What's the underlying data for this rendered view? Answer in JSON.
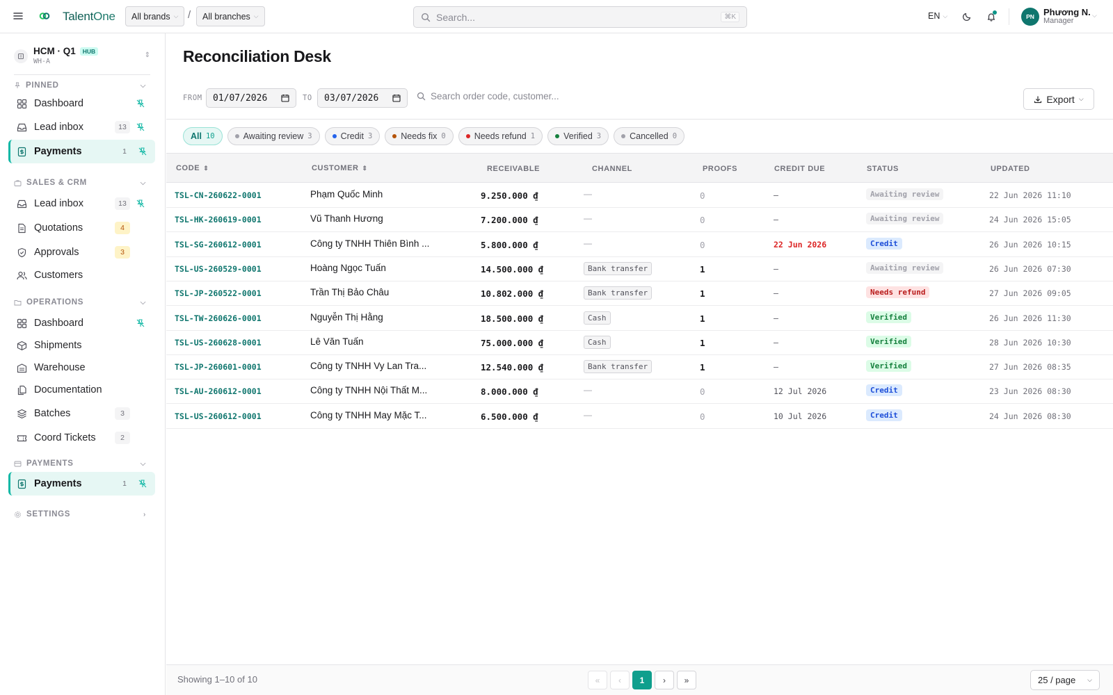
{
  "topbar": {
    "app_name_a": "Talent",
    "app_name_b": "One",
    "brand_select": "All brands",
    "separator": "/",
    "branch_select": "All branches",
    "search_placeholder": "Search...",
    "search_shortcut": "⌘K",
    "language": "EN",
    "user_initials": "PN",
    "user_name": "Phương N.",
    "user_role": "Manager",
    "icons": [
      "menu-icon",
      "logo-icon",
      "search-icon",
      "moon-icon",
      "bell-icon"
    ]
  },
  "sidebar": {
    "workspace": {
      "name": "HCM · Q1",
      "badge": "HUB",
      "code": "WH-A"
    },
    "sections": [
      {
        "label": "PINNED",
        "items": [
          {
            "label": "Dashboard",
            "icon": "grid-icon"
          },
          {
            "label": "Lead inbox",
            "count": "13",
            "icon": "inbox-icon"
          },
          {
            "label": "Payments",
            "count": "1",
            "icon": "receipt-icon",
            "active": true
          }
        ]
      },
      {
        "label": "SALES & CRM",
        "items": [
          {
            "label": "Lead inbox",
            "count": "13",
            "icon": "inbox-icon"
          },
          {
            "label": "Quotations",
            "count": "4",
            "icon": "document-icon"
          },
          {
            "label": "Approvals",
            "count": "3",
            "icon": "shield-check-icon"
          },
          {
            "label": "Customers",
            "icon": "users-icon"
          }
        ]
      },
      {
        "label": "OPERATIONS",
        "items": [
          {
            "label": "Dashboard",
            "icon": "grid-icon"
          },
          {
            "label": "Shipments",
            "icon": "box-icon"
          },
          {
            "label": "Warehouse",
            "icon": "warehouse-icon"
          },
          {
            "label": "Documentation",
            "icon": "files-icon"
          },
          {
            "label": "Batches",
            "count": "3",
            "icon": "layers-icon"
          },
          {
            "label": "Coord Tickets",
            "count": "2",
            "icon": "ticket-icon"
          }
        ]
      },
      {
        "label": "PAYMENTS",
        "items": [
          {
            "label": "Payments",
            "count": "1",
            "icon": "receipt-icon",
            "active": true
          }
        ]
      },
      {
        "label": "SETTINGS"
      }
    ]
  },
  "page": {
    "title": "Reconciliation Desk",
    "from_label": "FROM",
    "from_date": "01/07/2026",
    "to_label": "TO",
    "to_date": "03/07/2026",
    "search_placeholder": "Search order code, customer...",
    "export_label": "Export"
  },
  "filters": [
    {
      "label": "All",
      "count": "10",
      "active": true
    },
    {
      "label": "Awaiting review",
      "count": "3",
      "color": "#a1a1aa"
    },
    {
      "label": "Credit",
      "count": "3",
      "color": "#2563eb"
    },
    {
      "label": "Needs fix",
      "count": "0",
      "color": "#b45309"
    },
    {
      "label": "Needs refund",
      "count": "1",
      "color": "#dc2626"
    },
    {
      "label": "Verified",
      "count": "3",
      "color": "#15803d"
    },
    {
      "label": "Cancelled",
      "count": "0",
      "color": "#a1a1aa"
    }
  ],
  "table": {
    "headers": [
      "CODE",
      "CUSTOMER",
      "RECEIVABLE",
      "CHANNEL",
      "PROOFS",
      "CREDIT DUE",
      "STATUS",
      "UPDATED"
    ],
    "rows": [
      {
        "code": "TSL-CN-260622-0001",
        "customer": "Phạm Quốc Minh",
        "amount": "9.250.000 ₫",
        "channel": "—",
        "proofs": "0",
        "due": "—",
        "status": "Awaiting review",
        "updated": "22 Jun 2026 11:10"
      },
      {
        "code": "TSL-HK-260619-0001",
        "customer": "Vũ Thanh Hương",
        "amount": "7.200.000 ₫",
        "channel": "—",
        "proofs": "0",
        "due": "—",
        "status": "Awaiting review",
        "updated": "24 Jun 2026 15:05"
      },
      {
        "code": "TSL-SG-260612-0001",
        "customer": "Công ty TNHH Thiên Bình ...",
        "amount": "5.800.000 ₫",
        "channel": "—",
        "proofs": "0",
        "due": "22 Jun 2026",
        "due_overdue": true,
        "status": "Credit",
        "updated": "26 Jun 2026 10:15"
      },
      {
        "code": "TSL-US-260529-0001",
        "customer": "Hoàng Ngọc Tuấn",
        "amount": "14.500.000 ₫",
        "channel": "Bank transfer",
        "proofs": "1",
        "due": "—",
        "status": "Awaiting review",
        "updated": "26 Jun 2026 07:30"
      },
      {
        "code": "TSL-JP-260522-0001",
        "customer": "Trần Thị Bảo Châu",
        "amount": "10.802.000 ₫",
        "channel": "Bank transfer",
        "proofs": "1",
        "due": "—",
        "status": "Needs refund",
        "updated": "27 Jun 2026 09:05"
      },
      {
        "code": "TSL-TW-260626-0001",
        "customer": "Nguyễn Thị Hằng",
        "amount": "18.500.000 ₫",
        "channel": "Cash",
        "proofs": "1",
        "due": "—",
        "status": "Verified",
        "updated": "26 Jun 2026 11:30"
      },
      {
        "code": "TSL-US-260628-0001",
        "customer": "Lê Văn Tuấn",
        "amount": "75.000.000 ₫",
        "channel": "Cash",
        "proofs": "1",
        "due": "—",
        "status": "Verified",
        "updated": "28 Jun 2026 10:30"
      },
      {
        "code": "TSL-JP-260601-0001",
        "customer": "Công ty TNHH Vy Lan Tra...",
        "amount": "12.540.000 ₫",
        "channel": "Bank transfer",
        "proofs": "1",
        "due": "—",
        "status": "Verified",
        "updated": "27 Jun 2026 08:35"
      },
      {
        "code": "TSL-AU-260612-0001",
        "customer": "Công ty TNHH Nội Thất M...",
        "amount": "8.000.000 ₫",
        "channel": "—",
        "proofs": "0",
        "due": "12 Jul 2026",
        "status": "Credit",
        "updated": "23 Jun 2026 08:30"
      },
      {
        "code": "TSL-US-260612-0001",
        "customer": "Công ty TNHH May Mặc T...",
        "amount": "6.500.000 ₫",
        "channel": "—",
        "proofs": "0",
        "due": "10 Jul 2026",
        "status": "Credit",
        "updated": "24 Jun 2026 08:30"
      }
    ]
  },
  "footer": {
    "showing": "Showing 1–10 of 10",
    "first": "«",
    "prev": "‹",
    "current_page": "1",
    "next": "›",
    "last": "»",
    "per_page": "25 / page"
  }
}
